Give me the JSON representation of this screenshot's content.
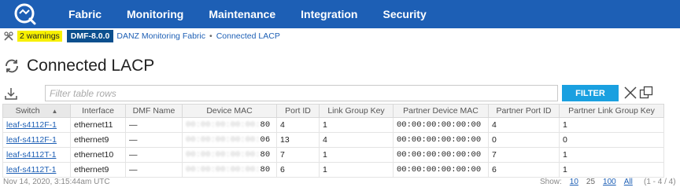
{
  "nav": {
    "items": [
      "Fabric",
      "Monitoring",
      "Maintenance",
      "Integration",
      "Security"
    ]
  },
  "breadcrumb": {
    "warnings": "2 warnings",
    "version": "DMF-8.0.0",
    "fabric": "DANZ Monitoring Fabric",
    "separator": "•",
    "current": "Connected LACP"
  },
  "page": {
    "title": "Connected LACP"
  },
  "filter": {
    "placeholder": "Filter table rows",
    "button": "FILTER"
  },
  "table": {
    "headers": [
      "Switch",
      "Interface",
      "DMF Name",
      "Device MAC",
      "Port ID",
      "Link Group Key",
      "Partner Device MAC",
      "Partner Port ID",
      "Partner Link Group Key"
    ],
    "rows": [
      {
        "switch": "leaf-s4112F-1",
        "interface": "ethernet11",
        "dmf_name": "—",
        "device_mac_masked": "00:00:00:00:00:",
        "device_mac_suffix": "80",
        "port_id": "4",
        "link_group_key": "1",
        "partner_mac": "00:00:00:00:00:00",
        "partner_port_id": "4",
        "partner_link_group_key": "1"
      },
      {
        "switch": "leaf-s4112F-1",
        "interface": "ethernet9",
        "dmf_name": "—",
        "device_mac_masked": "00:00:00:00:00:",
        "device_mac_suffix": "06",
        "port_id": "13",
        "link_group_key": "4",
        "partner_mac": "00:00:00:00:00:00",
        "partner_port_id": "0",
        "partner_link_group_key": "0"
      },
      {
        "switch": "leaf-s4112T-1",
        "interface": "ethernet10",
        "dmf_name": "—",
        "device_mac_masked": "00:00:00:00:00:",
        "device_mac_suffix": "80",
        "port_id": "7",
        "link_group_key": "1",
        "partner_mac": "00:00:00:00:00:00",
        "partner_port_id": "7",
        "partner_link_group_key": "1"
      },
      {
        "switch": "leaf-s4112T-1",
        "interface": "ethernet9",
        "dmf_name": "—",
        "device_mac_masked": "00:00:00:00:00:",
        "device_mac_suffix": "80",
        "port_id": "6",
        "link_group_key": "1",
        "partner_mac": "00:00:00:00:00:00",
        "partner_port_id": "6",
        "partner_link_group_key": "1"
      }
    ]
  },
  "footer": {
    "timestamp": "Nov 14, 2020, 3:15:44am UTC",
    "show_label": "Show:",
    "page_sizes": [
      "10",
      "25",
      "100",
      "All"
    ],
    "range": "(1 - 4 / 4)"
  },
  "colors": {
    "nav_bg": "#1d5fb5",
    "filter_button": "#1aa0e0",
    "warning_badge": "#f7f000",
    "version_badge": "#0b4f8e"
  },
  "icons": [
    "logo-icon",
    "tools-icon",
    "refresh-icon",
    "download-icon",
    "clear-filter-icon",
    "multi-window-icon",
    "sort-asc-icon"
  ]
}
